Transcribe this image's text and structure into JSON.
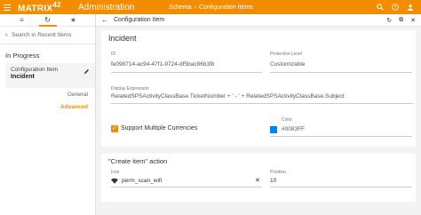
{
  "topbar": {
    "logo": "MATRIX",
    "logo_version": "42",
    "app_title": "Administration",
    "breadcrumb": [
      "Schema",
      "Configuration Items"
    ],
    "breadcrumb_sep": "›",
    "accent": "#f28c00"
  },
  "sidebar": {
    "tabs": [
      "≡",
      "↻",
      "★"
    ],
    "search_placeholder": "Search in Recent Items",
    "section": "In Progress",
    "item": {
      "type": "Configuration Item",
      "name": "Incident"
    },
    "sub_items": [
      "General",
      "Advanced"
    ]
  },
  "main": {
    "header_title": "Configuration Item",
    "card": {
      "title": "Incident",
      "id_label": "ID",
      "id_value": "fe098714-ac94-47f1-9724-df5bac86b3fb",
      "protection_label": "Protection Level",
      "protection_value": "Customizable",
      "display_label": "Display Expression",
      "display_value": "RelatedSPSActivityClassBase.TicketNumber + ' - ' + RelatedSPSActivityClassBase.Subject",
      "multi_currency_label": "Support Multiple Currencies",
      "multi_currency_checked": true,
      "color_label": "Color",
      "color_value": "#0083FF"
    },
    "action_card": {
      "title": "\"Create item\" action",
      "icon_label": "Icon",
      "icon_value": "perm_scan_wifi",
      "position_label": "Position",
      "position_value": "10"
    }
  }
}
